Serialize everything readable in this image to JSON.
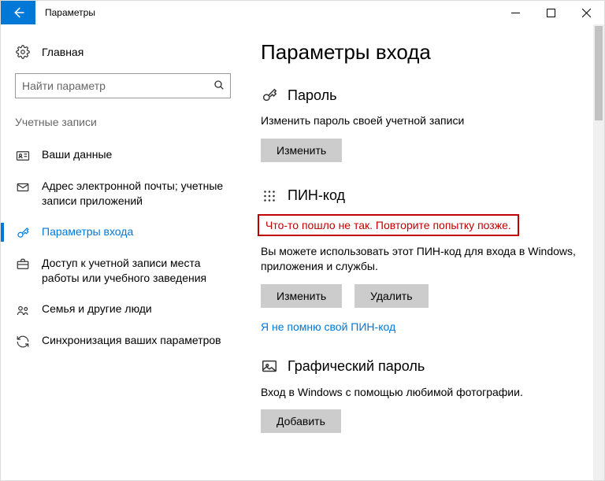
{
  "window": {
    "title": "Параметры"
  },
  "sidebar": {
    "home_label": "Главная",
    "search_placeholder": "Найти параметр",
    "group_header": "Учетные записи",
    "items": [
      {
        "label": "Ваши данные"
      },
      {
        "label": "Адрес электронной почты; учетные записи приложений"
      },
      {
        "label": "Параметры входа"
      },
      {
        "label": "Доступ к учетной записи места работы или учебного заведения"
      },
      {
        "label": "Семья и другие люди"
      },
      {
        "label": "Синхронизация ваших параметров"
      }
    ]
  },
  "main": {
    "page_title": "Параметры входа",
    "password": {
      "title": "Пароль",
      "desc": "Изменить пароль своей учетной записи",
      "change_btn": "Изменить"
    },
    "pin": {
      "title": "ПИН-код",
      "error": "Что-то пошло не так. Повторите попытку позже.",
      "desc": "Вы можете использовать этот ПИН-код для входа в Windows, приложения и службы.",
      "change_btn": "Изменить",
      "remove_btn": "Удалить",
      "forgot_link": "Я не помню свой ПИН-код"
    },
    "picture": {
      "title": "Графический пароль",
      "desc": "Вход в Windows с помощью любимой фотографии.",
      "add_btn": "Добавить"
    }
  }
}
